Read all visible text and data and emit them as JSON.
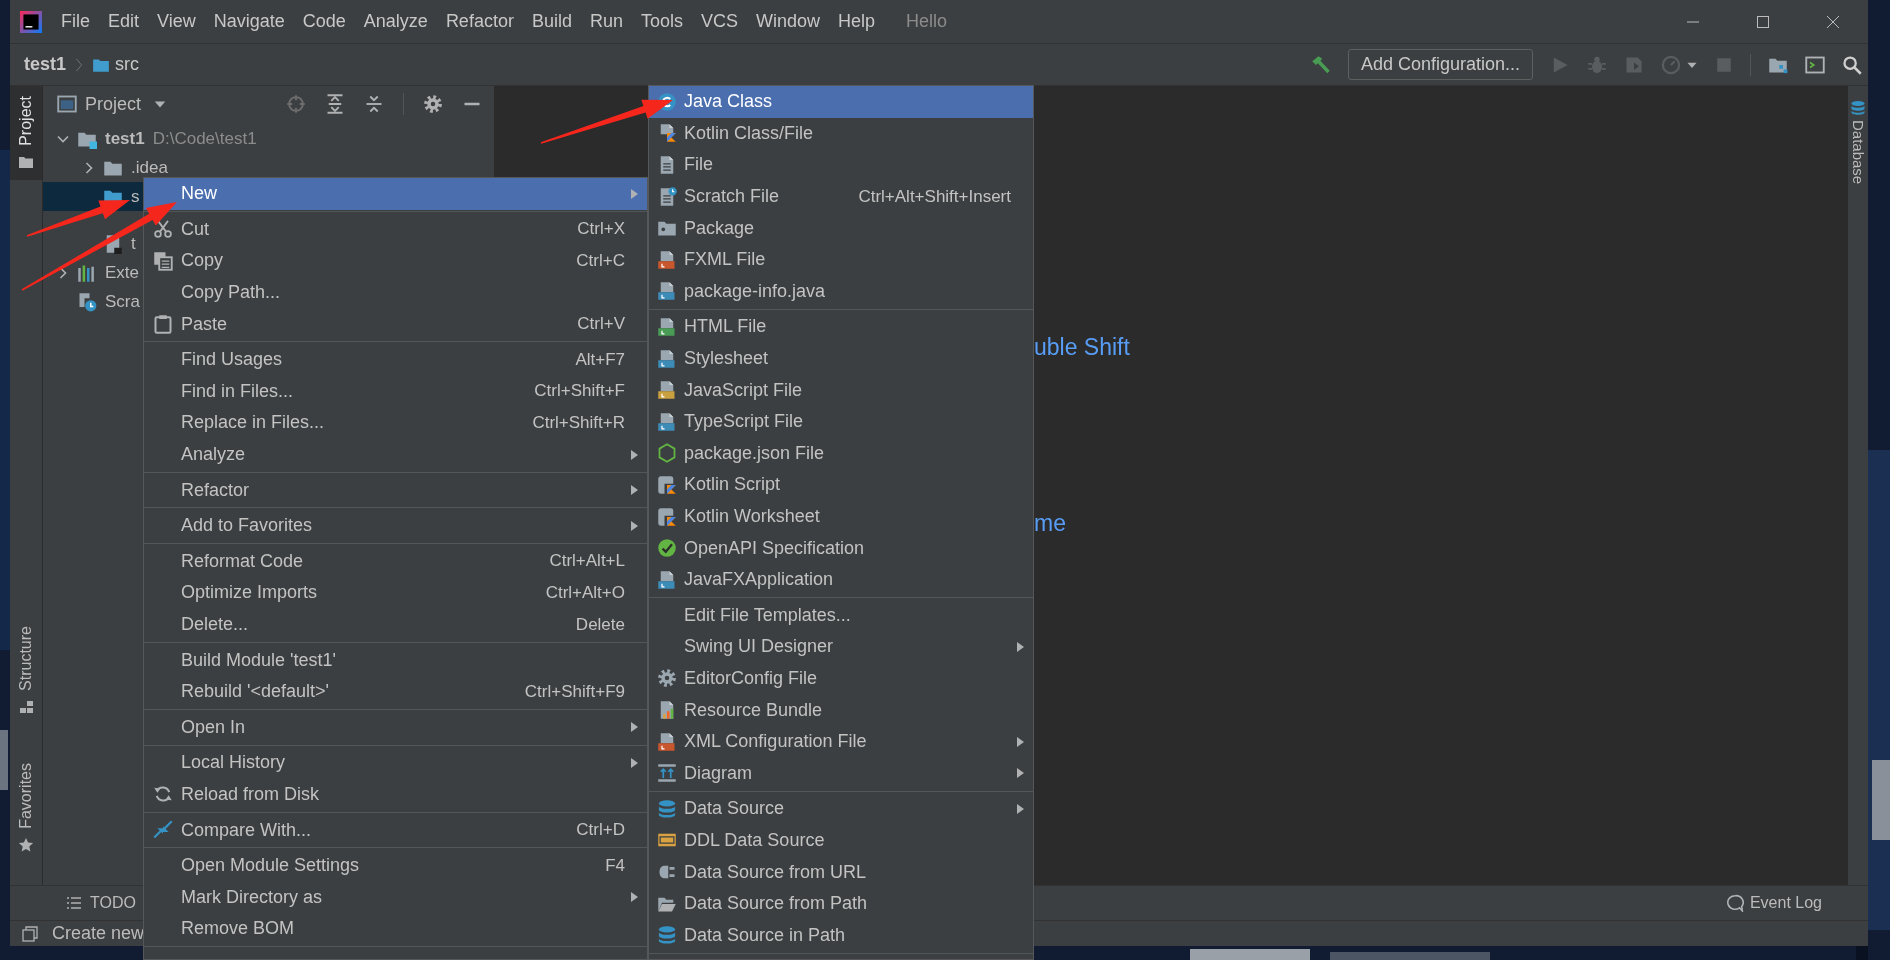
{
  "title_bar": {
    "menu": [
      "File",
      "Edit",
      "View",
      "Navigate",
      "Code",
      "Analyze",
      "Refactor",
      "Build",
      "Run",
      "Tools",
      "VCS",
      "Window",
      "Help"
    ],
    "project": "Hello"
  },
  "nav_bar": {
    "breadcrumbs": [
      "test1",
      "src"
    ],
    "run_configuration": "Add Configuration..."
  },
  "left_tool_strip": {
    "top": [
      {
        "label": "Project",
        "kind": "project",
        "selected": true
      }
    ],
    "bottom": [
      {
        "label": "Structure",
        "kind": "structure",
        "selected": false
      },
      {
        "label": "Favorites",
        "kind": "favorites",
        "selected": false
      }
    ]
  },
  "right_tool_strip": [
    {
      "label": "Database",
      "kind": "database",
      "selected": false
    }
  ],
  "project_panel": {
    "title": "Project",
    "tree": [
      {
        "label": "test1",
        "path": "D:\\Code\\test1",
        "kind": "module",
        "expanded": true,
        "selected": false,
        "children": [
          {
            "label": ".idea",
            "kind": "folder",
            "expanded": false,
            "selected": false
          },
          {
            "label": "s",
            "kind": "source",
            "selected": true
          },
          {
            "label": "t",
            "kind": "file",
            "selected": false
          }
        ]
      },
      {
        "label": "Exte",
        "kind": "library",
        "expanded": false,
        "selected": false
      },
      {
        "label": "Scra",
        "kind": "scratches",
        "selected": false
      }
    ]
  },
  "editor": {
    "hints": [
      "uble Shift",
      "me"
    ]
  },
  "context_menu": {
    "items": [
      {
        "label": "New",
        "kind": "plain",
        "submenu": true,
        "selected": true
      },
      {
        "kind": "separator"
      },
      {
        "label": "Cut",
        "shortcut": "Ctrl+X",
        "kind": "cut",
        "submenu": false,
        "selected": false
      },
      {
        "label": "Copy",
        "shortcut": "Ctrl+C",
        "kind": "copy",
        "submenu": false,
        "selected": false
      },
      {
        "label": "Copy Path...",
        "kind": "plain",
        "submenu": false,
        "selected": false
      },
      {
        "label": "Paste",
        "shortcut": "Ctrl+V",
        "kind": "paste",
        "submenu": false,
        "selected": false
      },
      {
        "kind": "separator"
      },
      {
        "label": "Find Usages",
        "shortcut": "Alt+F7",
        "kind": "plain",
        "submenu": false,
        "selected": false
      },
      {
        "label": "Find in Files...",
        "shortcut": "Ctrl+Shift+F",
        "kind": "plain",
        "submenu": false,
        "selected": false
      },
      {
        "label": "Replace in Files...",
        "shortcut": "Ctrl+Shift+R",
        "kind": "plain",
        "submenu": false,
        "selected": false
      },
      {
        "label": "Analyze",
        "kind": "plain",
        "submenu": true,
        "selected": false
      },
      {
        "kind": "separator"
      },
      {
        "label": "Refactor",
        "kind": "plain",
        "submenu": true,
        "selected": false
      },
      {
        "kind": "separator"
      },
      {
        "label": "Add to Favorites",
        "kind": "plain",
        "submenu": true,
        "selected": false
      },
      {
        "kind": "separator"
      },
      {
        "label": "Reformat Code",
        "shortcut": "Ctrl+Alt+L",
        "kind": "plain",
        "submenu": false,
        "selected": false
      },
      {
        "label": "Optimize Imports",
        "shortcut": "Ctrl+Alt+O",
        "kind": "plain",
        "submenu": false,
        "selected": false
      },
      {
        "label": "Delete...",
        "shortcut": "Delete",
        "kind": "plain",
        "submenu": false,
        "selected": false
      },
      {
        "kind": "separator"
      },
      {
        "label": "Build Module 'test1'",
        "kind": "plain",
        "submenu": false,
        "selected": false
      },
      {
        "label": "Rebuild '<default>'",
        "shortcut": "Ctrl+Shift+F9",
        "kind": "plain",
        "submenu": false,
        "selected": false
      },
      {
        "kind": "separator"
      },
      {
        "label": "Open In",
        "kind": "plain",
        "submenu": true,
        "selected": false
      },
      {
        "kind": "separator"
      },
      {
        "label": "Local History",
        "kind": "plain",
        "submenu": true,
        "selected": false
      },
      {
        "label": "Reload from Disk",
        "kind": "reload",
        "submenu": false,
        "selected": false
      },
      {
        "kind": "separator"
      },
      {
        "label": "Compare With...",
        "shortcut": "Ctrl+D",
        "kind": "compare",
        "submenu": false,
        "selected": false
      },
      {
        "kind": "separator"
      },
      {
        "label": "Open Module Settings",
        "shortcut": "F4",
        "kind": "plain",
        "submenu": false,
        "selected": false
      },
      {
        "label": "Mark Directory as",
        "kind": "plain",
        "submenu": true,
        "selected": false
      },
      {
        "label": "Remove BOM",
        "kind": "plain",
        "submenu": false,
        "selected": false
      },
      {
        "kind": "separator"
      }
    ]
  },
  "submenu": {
    "items": [
      {
        "label": "Java Class",
        "kind": "class",
        "submenu": false,
        "selected": true
      },
      {
        "label": "Kotlin Class/File",
        "kind": "kotlin",
        "submenu": false,
        "selected": false
      },
      {
        "label": "File",
        "kind": "file",
        "submenu": false,
        "selected": false
      },
      {
        "label": "Scratch File",
        "shortcut": "Ctrl+Alt+Shift+Insert",
        "kind": "scratch",
        "submenu": false,
        "selected": false
      },
      {
        "label": "Package",
        "kind": "package",
        "submenu": false,
        "selected": false
      },
      {
        "label": "FXML File",
        "kind": "orange",
        "submenu": false,
        "selected": false
      },
      {
        "label": "package-info.java",
        "kind": "blue",
        "submenu": false,
        "selected": false
      },
      {
        "kind": "separator"
      },
      {
        "label": "HTML File",
        "kind": "green",
        "submenu": false,
        "selected": false
      },
      {
        "label": "Stylesheet",
        "kind": "blue",
        "submenu": false,
        "selected": false
      },
      {
        "label": "JavaScript File",
        "kind": "yellow",
        "submenu": false,
        "selected": false
      },
      {
        "label": "TypeScript File",
        "kind": "blue",
        "submenu": false,
        "selected": false
      },
      {
        "label": "package.json File",
        "kind": "hexagon",
        "submenu": false,
        "selected": false
      },
      {
        "label": "Kotlin Script",
        "kind": "script",
        "submenu": false,
        "selected": false
      },
      {
        "label": "Kotlin Worksheet",
        "kind": "script",
        "submenu": false,
        "selected": false
      },
      {
        "label": "OpenAPI Specification",
        "kind": "check",
        "submenu": false,
        "selected": false
      },
      {
        "label": "JavaFXApplication",
        "kind": "blue",
        "submenu": false,
        "selected": false
      },
      {
        "kind": "separator"
      },
      {
        "label": "Edit File Templates...",
        "kind": "plain",
        "submenu": false,
        "selected": false
      },
      {
        "label": "Swing UI Designer",
        "kind": "plain",
        "submenu": true,
        "selected": false
      },
      {
        "label": "EditorConfig File",
        "kind": "gear",
        "submenu": false,
        "selected": false
      },
      {
        "label": "Resource Bundle",
        "kind": "bundle",
        "submenu": false,
        "selected": false
      },
      {
        "label": "XML Configuration File",
        "kind": "orange",
        "submenu": true,
        "selected": false
      },
      {
        "label": "Diagram",
        "kind": "diagram",
        "submenu": true,
        "selected": false
      },
      {
        "kind": "separator"
      },
      {
        "label": "Data Source",
        "kind": "database",
        "submenu": true,
        "selected": false
      },
      {
        "label": "DDL Data Source",
        "kind": "label",
        "submenu": false,
        "selected": false
      },
      {
        "label": "Data Source from URL",
        "kind": "plug",
        "submenu": false,
        "selected": false
      },
      {
        "label": "Data Source from Path",
        "kind": "openfolder",
        "submenu": false,
        "selected": false
      },
      {
        "label": "Data Source in Path",
        "kind": "database",
        "submenu": false,
        "selected": false
      },
      {
        "kind": "separator"
      }
    ]
  },
  "tool_window_bar": {
    "tabs": [
      {
        "label": "TODO",
        "selected": false
      }
    ],
    "event_log": "Event Log"
  },
  "status_bar": {
    "message": "Create new"
  }
}
